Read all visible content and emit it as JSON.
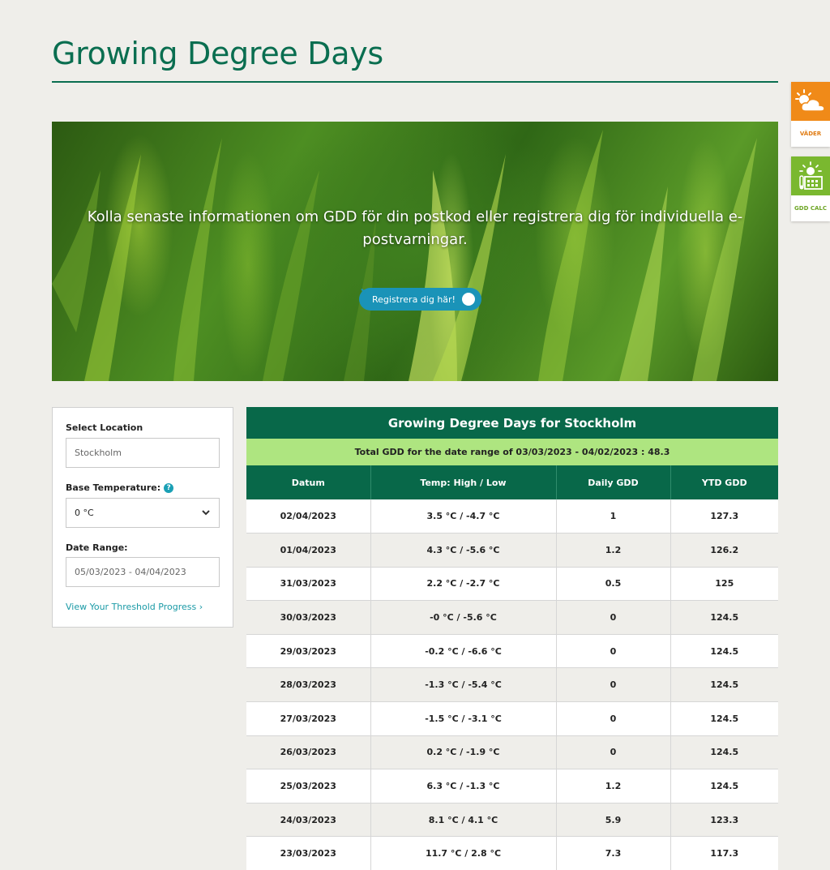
{
  "page": {
    "title": "Growing Degree Days"
  },
  "hero": {
    "text": "Kolla senaste informationen om GDD för din postkod eller registrera dig för individuella e-postvarningar.",
    "button_label": "Registrera dig här!"
  },
  "side_widgets": [
    {
      "label": "VÄDER",
      "icon": "weather-sun-cloud-icon",
      "color": "#f08a18"
    },
    {
      "label": "GDD CALC",
      "icon": "gdd-calculator-icon",
      "color": "#7ab82f"
    }
  ],
  "filters": {
    "location_label": "Select Location",
    "location_value": "Stockholm",
    "base_temp_label": "Base Temperature:",
    "base_temp_value": "0 °C",
    "date_range_label": "Date Range:",
    "date_range_value": "05/03/2023 - 04/04/2023",
    "threshold_link": "View Your Threshold Progress ›"
  },
  "table": {
    "title": "Growing Degree Days for Stockholm",
    "total": "Total GDD for the date range of 03/03/2023 - 04/02/2023 : 48.3",
    "columns": [
      "Datum",
      "Temp: High / Low",
      "Daily GDD",
      "YTD GDD"
    ],
    "rows": [
      [
        "02/04/2023",
        "3.5 °C / -4.7 °C",
        "1",
        "127.3"
      ],
      [
        "01/04/2023",
        "4.3 °C / -5.6 °C",
        "1.2",
        "126.2"
      ],
      [
        "31/03/2023",
        "2.2 °C / -2.7 °C",
        "0.5",
        "125"
      ],
      [
        "30/03/2023",
        "-0 °C / -5.6 °C",
        "0",
        "124.5"
      ],
      [
        "29/03/2023",
        "-0.2 °C / -6.6 °C",
        "0",
        "124.5"
      ],
      [
        "28/03/2023",
        "-1.3 °C / -5.4 °C",
        "0",
        "124.5"
      ],
      [
        "27/03/2023",
        "-1.5 °C / -3.1 °C",
        "0",
        "124.5"
      ],
      [
        "26/03/2023",
        "0.2 °C / -1.9 °C",
        "0",
        "124.5"
      ],
      [
        "25/03/2023",
        "6.3 °C / -1.3 °C",
        "1.2",
        "124.5"
      ],
      [
        "24/03/2023",
        "8.1 °C / 4.1 °C",
        "5.9",
        "123.3"
      ],
      [
        "23/03/2023",
        "11.7 °C / 2.8 °C",
        "7.3",
        "117.3"
      ]
    ]
  },
  "colors": {
    "brand_green": "#086849",
    "accent_green": "#aee580",
    "link_teal": "#1a9aa6",
    "button_blue": "#1a93b8"
  }
}
